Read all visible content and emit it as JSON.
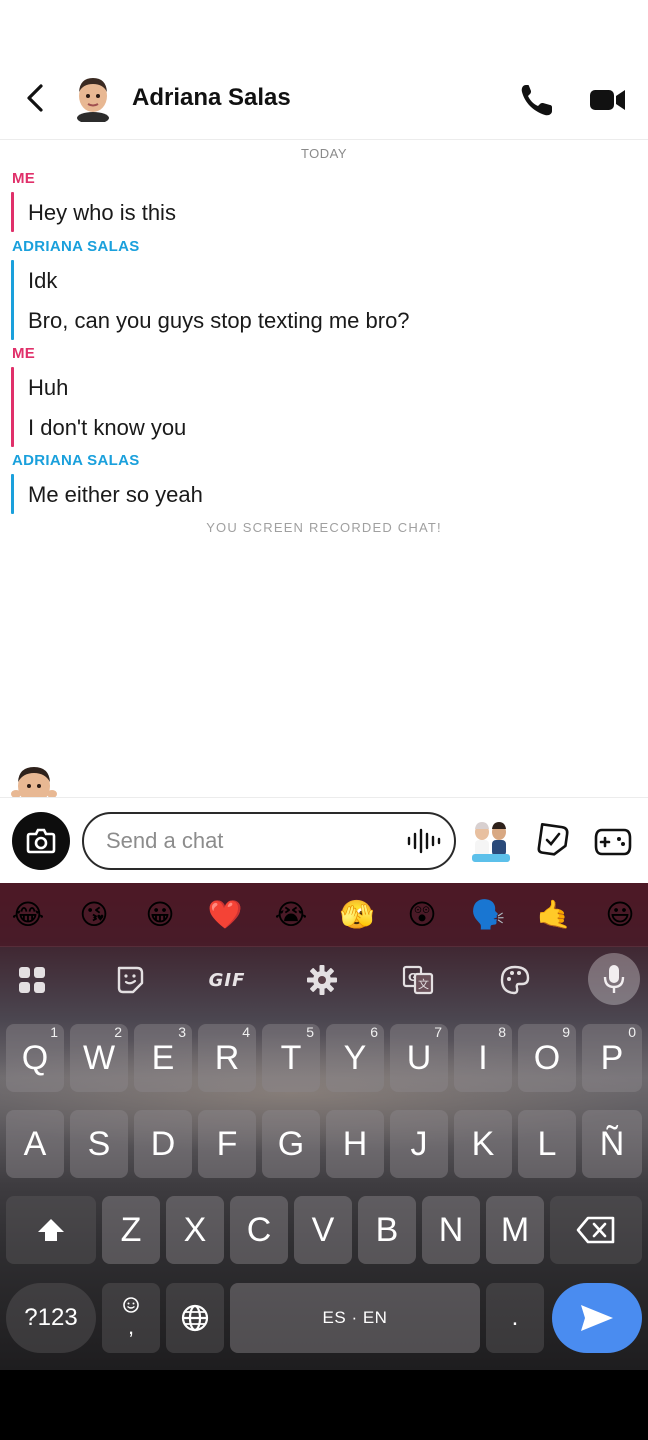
{
  "header": {
    "back_icon": "chevron-left-icon",
    "contact_name": "Adriana Salas",
    "call_icon": "phone-icon",
    "video_icon": "video-camera-icon"
  },
  "chat": {
    "date_divider": "TODAY",
    "groups": [
      {
        "sender": "ME",
        "messages": [
          "Hey who is this"
        ]
      },
      {
        "sender": "ADRIANA SALAS",
        "messages": [
          "Idk",
          "Bro, can you guys stop texting me bro?"
        ]
      },
      {
        "sender": "ME",
        "messages": [
          "Huh",
          "I don't know you"
        ]
      },
      {
        "sender": "ADRIANA SALAS",
        "messages": [
          "Me either so yeah"
        ]
      }
    ],
    "system_notice": "YOU SCREEN RECORDED CHAT!"
  },
  "input_bar": {
    "camera_icon": "camera-icon",
    "placeholder": "Send a chat",
    "voice_icon": "voice-waveform-icon",
    "bitmoji_icon": "bitmoji-icon",
    "sticker_icon": "sticker-icon",
    "game_icon": "game-controller-icon"
  },
  "keyboard": {
    "emojis": [
      "😂",
      "😘",
      "😀",
      "❤️",
      "😭",
      "🫣",
      "😲",
      "🗣️",
      "🤙",
      "😃"
    ],
    "toolbar": {
      "apps_icon": "apps-grid-icon",
      "sticker_icon": "sticker-icon",
      "gif_label": "GIF",
      "settings_icon": "gear-icon",
      "translate_icon": "translate-icon",
      "theme_icon": "palette-icon",
      "mic_icon": "microphone-icon"
    },
    "row1": [
      "Q",
      "W",
      "E",
      "R",
      "T",
      "Y",
      "U",
      "I",
      "O",
      "P"
    ],
    "row1_hints": [
      "1",
      "2",
      "3",
      "4",
      "5",
      "6",
      "7",
      "8",
      "9",
      "0"
    ],
    "row2": [
      "A",
      "S",
      "D",
      "F",
      "G",
      "H",
      "J",
      "K",
      "L",
      "Ñ"
    ],
    "row3": [
      "Z",
      "X",
      "C",
      "V",
      "B",
      "N",
      "M"
    ],
    "shift_icon": "shift-icon",
    "backspace_icon": "backspace-icon",
    "symbols_label": "?123",
    "emoji_key_label": ",",
    "emoji_key_icon": "smiley-icon",
    "globe_icon": "globe-icon",
    "space_label": "ES · EN",
    "period_label": ".",
    "enter_icon": "send-arrow-icon"
  }
}
